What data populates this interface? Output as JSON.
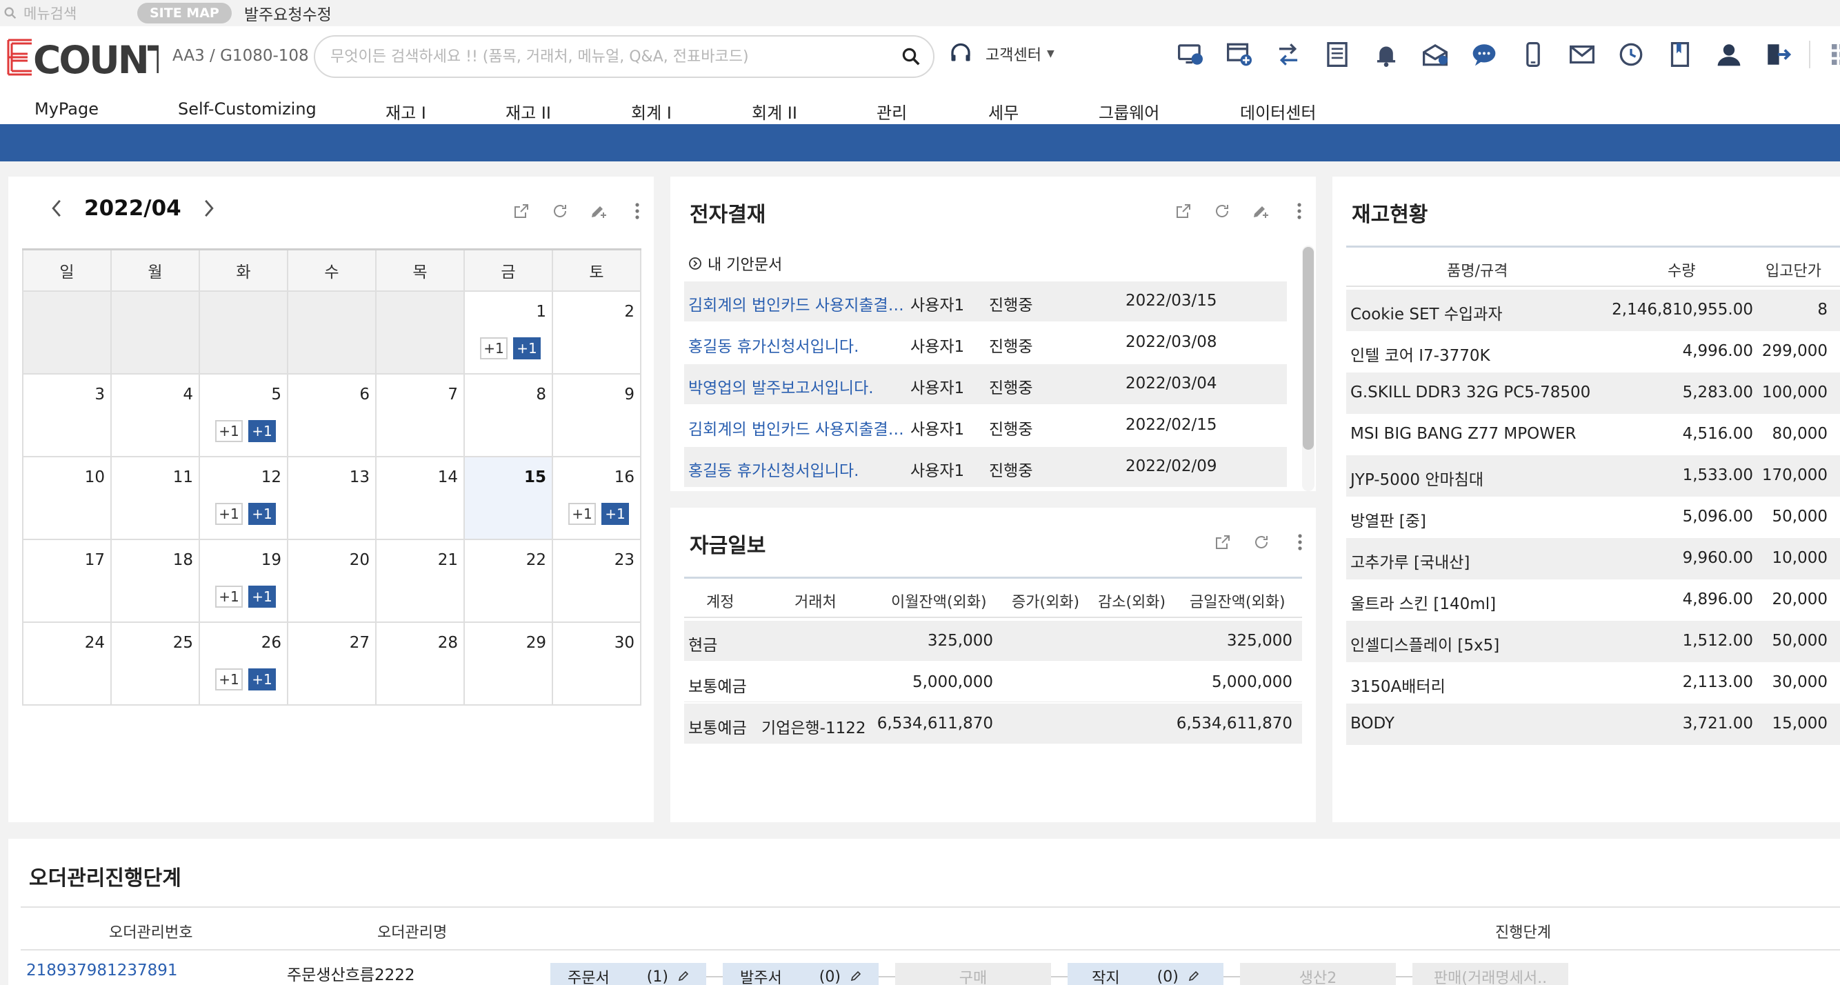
{
  "topbar": {
    "menu_search": "메뉴검색",
    "sitemap": "SITE MAP",
    "request_edit": "발주요청수정"
  },
  "header": {
    "company": "AA3 / G1080-108",
    "search_placeholder": "무엇이든 검색하세요 !! (품목, 거래처, 메뉴얼, Q&A, 전표바코드)",
    "customer_center": "고객센터",
    "icons": [
      "monitor-icon",
      "window-add-icon",
      "transfer-icon",
      "document-list-icon",
      "bell-icon",
      "envelope-open-icon",
      "chat-icon",
      "mobile-icon",
      "mail-icon",
      "clock-icon",
      "bookmark-icon",
      "user-icon",
      "logout-icon",
      "grid-menu-icon"
    ]
  },
  "nav": [
    "MyPage",
    "Self-Customizing",
    "재고 I",
    "재고 II",
    "회계 I",
    "회계 II",
    "관리",
    "세무",
    "그룹웨어",
    "데이터센터"
  ],
  "calendar": {
    "month": "2022/04",
    "weekdays": [
      "일",
      "월",
      "화",
      "수",
      "목",
      "금",
      "토"
    ],
    "weeks": [
      [
        {
          "d": ""
        },
        {
          "d": ""
        },
        {
          "d": ""
        },
        {
          "d": ""
        },
        {
          "d": ""
        },
        {
          "d": "1",
          "b": [
            "+1",
            "+1"
          ]
        },
        {
          "d": "2"
        }
      ],
      [
        {
          "d": "3"
        },
        {
          "d": "4"
        },
        {
          "d": "5",
          "b": [
            "+1",
            "+1"
          ]
        },
        {
          "d": "6"
        },
        {
          "d": "7"
        },
        {
          "d": "8"
        },
        {
          "d": "9"
        }
      ],
      [
        {
          "d": "10"
        },
        {
          "d": "11"
        },
        {
          "d": "12",
          "b": [
            "+1",
            "+1"
          ]
        },
        {
          "d": "13"
        },
        {
          "d": "14"
        },
        {
          "d": "15",
          "today": true
        },
        {
          "d": "16",
          "b": [
            "+1",
            "+1"
          ]
        }
      ],
      [
        {
          "d": "17"
        },
        {
          "d": "18"
        },
        {
          "d": "19",
          "b": [
            "+1",
            "+1"
          ]
        },
        {
          "d": "20"
        },
        {
          "d": "21"
        },
        {
          "d": "22"
        },
        {
          "d": "23"
        }
      ],
      [
        {
          "d": "24"
        },
        {
          "d": "25"
        },
        {
          "d": "26",
          "b": [
            "+1",
            "+1"
          ]
        },
        {
          "d": "27"
        },
        {
          "d": "28"
        },
        {
          "d": "29"
        },
        {
          "d": "30"
        }
      ]
    ]
  },
  "approval": {
    "title": "전자결재",
    "subtitle": "내 기안문서",
    "rows": [
      {
        "doc": "김회계의 법인카드 사용지출결…",
        "user": "사용자1",
        "status": "진행중",
        "date": "2022/03/15"
      },
      {
        "doc": "홍길동 휴가신청서입니다.",
        "user": "사용자1",
        "status": "진행중",
        "date": "2022/03/08"
      },
      {
        "doc": "박영업의 발주보고서입니다.",
        "user": "사용자1",
        "status": "진행중",
        "date": "2022/03/04"
      },
      {
        "doc": "김회계의 법인카드 사용지출결…",
        "user": "사용자1",
        "status": "진행중",
        "date": "2022/02/15"
      },
      {
        "doc": "홍길동 휴가신청서입니다.",
        "user": "사용자1",
        "status": "진행중",
        "date": "2022/02/09"
      }
    ]
  },
  "funds": {
    "title": "자금일보",
    "headers": [
      "계정",
      "거래처",
      "이월잔액(외화)",
      "증가(외화)",
      "감소(외화)",
      "금일잔액(외화)"
    ],
    "rows": [
      {
        "account": "현금",
        "client": "",
        "carry": "325,000",
        "inc": "",
        "dec": "",
        "today": "325,000"
      },
      {
        "account": "보통예금",
        "client": "",
        "carry": "5,000,000",
        "inc": "",
        "dec": "",
        "today": "5,000,000"
      },
      {
        "account": "보통예금",
        "client": "기업은행-1122",
        "carry": "6,534,611,870",
        "inc": "",
        "dec": "",
        "today": "6,534,611,870"
      }
    ]
  },
  "inventory": {
    "title": "재고현황",
    "headers": [
      "품명/규격",
      "수량",
      "입고단가"
    ],
    "rows": [
      {
        "item": "Cookie SET 수입과자",
        "qty": "2,146,810,955.00",
        "price": "8"
      },
      {
        "item": "인텔 코어 I7-3770K",
        "qty": "4,996.00",
        "price": "299,000"
      },
      {
        "item": "G.SKILL DDR3 32G PC5-78500",
        "qty": "5,283.00",
        "price": "100,000"
      },
      {
        "item": "MSI BIG BANG Z77 MPOWER",
        "qty": "4,516.00",
        "price": "80,000"
      },
      {
        "item": "JYP-5000 안마침대",
        "qty": "1,533.00",
        "price": "170,000"
      },
      {
        "item": "방열판 [중]",
        "qty": "5,096.00",
        "price": "50,000"
      },
      {
        "item": "고추가루 [국내산]",
        "qty": "9,960.00",
        "price": "10,000"
      },
      {
        "item": "울트라 스킨 [140ml]",
        "qty": "4,896.00",
        "price": "20,000"
      },
      {
        "item": "인셀디스플레이 [5x5]",
        "qty": "1,512.00",
        "price": "50,000"
      },
      {
        "item": "3150A배터리",
        "qty": "2,113.00",
        "price": "30,000"
      },
      {
        "item": "BODY",
        "qty": "3,721.00",
        "price": "15,000"
      }
    ]
  },
  "order": {
    "title": "오더관리진행단계",
    "headers": [
      "오더관리번호",
      "오더관리명",
      "진행단계"
    ],
    "row": {
      "no": "218937981237891",
      "name": "주문생산흐름2222"
    },
    "stages": [
      {
        "label": "주문서",
        "count": "(1)",
        "active": true
      },
      {
        "label": "발주서",
        "count": "(0)",
        "active": true
      },
      {
        "label": "구매",
        "count": "",
        "active": false
      },
      {
        "label": "작지",
        "count": "(0)",
        "active": true
      },
      {
        "label": "생산2",
        "count": "",
        "active": false
      },
      {
        "label": "판매(거래명세서..",
        "count": "",
        "active": false
      }
    ]
  }
}
